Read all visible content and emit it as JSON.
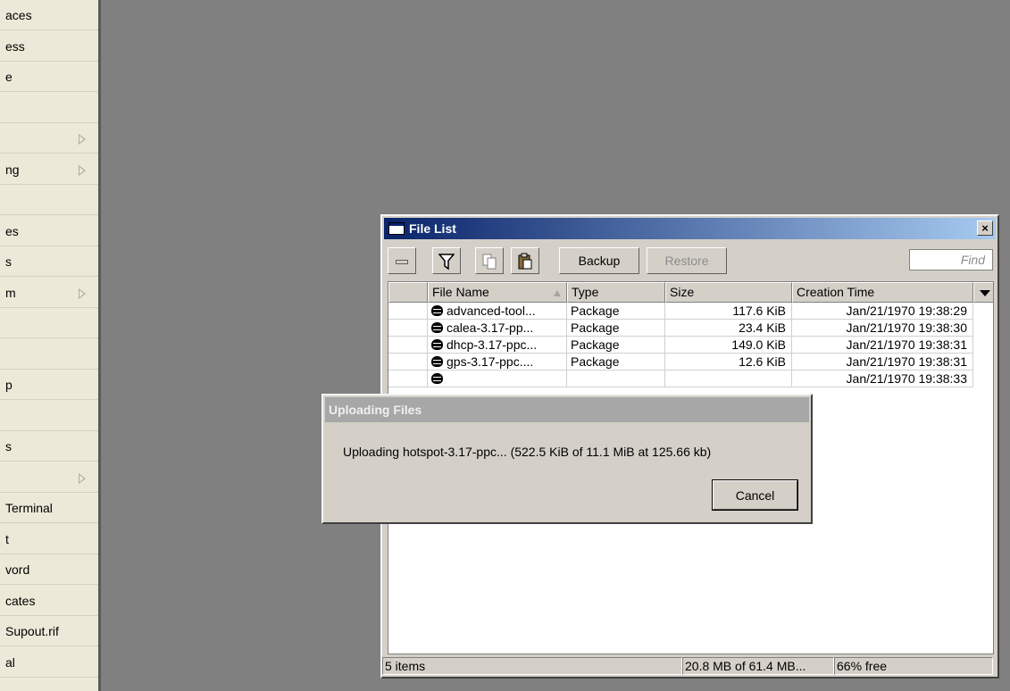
{
  "sidebar": {
    "items": [
      {
        "label": "aces",
        "submenu": false
      },
      {
        "label": "ess",
        "submenu": false
      },
      {
        "label": "e",
        "submenu": false
      },
      {
        "label": "",
        "submenu": false
      },
      {
        "label": "",
        "submenu": true
      },
      {
        "label": "ng",
        "submenu": true
      },
      {
        "label": "",
        "submenu": false
      },
      {
        "label": "es",
        "submenu": false
      },
      {
        "label": "s",
        "submenu": false
      },
      {
        "label": "m",
        "submenu": true
      },
      {
        "label": "",
        "submenu": false
      },
      {
        "label": "",
        "submenu": false
      },
      {
        "label": "p",
        "submenu": false
      },
      {
        "label": "",
        "submenu": false
      },
      {
        "label": "s",
        "submenu": false
      },
      {
        "label": "",
        "submenu": true
      },
      {
        "label": "Terminal",
        "submenu": false
      },
      {
        "label": "t",
        "submenu": false
      },
      {
        "label": "vord",
        "submenu": false
      },
      {
        "label": "cates",
        "submenu": false
      },
      {
        "label": " Supout.rif",
        "submenu": false
      },
      {
        "label": "al",
        "submenu": false
      }
    ]
  },
  "file_window": {
    "title": "File List",
    "close_label": "×",
    "toolbar": {
      "backup_label": "Backup",
      "restore_label": "Restore",
      "find_placeholder": "Find"
    },
    "columns": [
      "File Name",
      "Type",
      "Size",
      "Creation Time"
    ],
    "rows": [
      {
        "name": "advanced-tool...",
        "type": "Package",
        "size": "117.6 KiB",
        "time": "Jan/21/1970 19:38:29"
      },
      {
        "name": "calea-3.17-pp...",
        "type": "Package",
        "size": "23.4 KiB",
        "time": "Jan/21/1970 19:38:30"
      },
      {
        "name": "dhcp-3.17-ppc...",
        "type": "Package",
        "size": "149.0 KiB",
        "time": "Jan/21/1970 19:38:31"
      },
      {
        "name": "gps-3.17-ppc....",
        "type": "Package",
        "size": "12.6 KiB",
        "time": "Jan/21/1970 19:38:31"
      },
      {
        "name": "",
        "type": "",
        "size": "",
        "time": "Jan/21/1970 19:38:33"
      }
    ],
    "status": {
      "items": "5 items",
      "disk": "20.8 MB of 61.4 MB...",
      "free": "66% free"
    }
  },
  "upload_dialog": {
    "title": "Uploading Files",
    "message": "Uploading hotspot-3.17-ppc... (522.5 KiB of 11.1 MiB at 125.66 kb)",
    "cancel_label": "Cancel"
  }
}
